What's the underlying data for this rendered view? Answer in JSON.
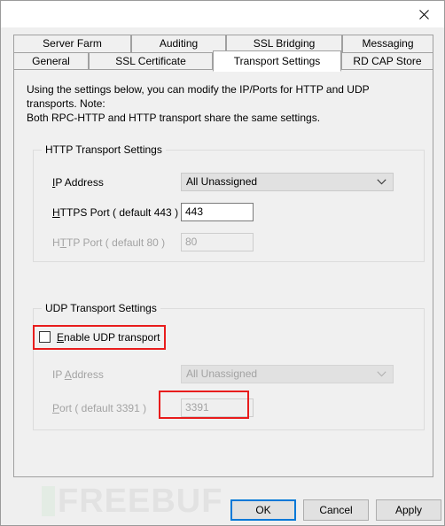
{
  "window": {
    "title": "",
    "close_icon": "close-icon"
  },
  "tabs": {
    "row_top": [
      {
        "label": "Server Farm",
        "selected": false
      },
      {
        "label": "Auditing",
        "selected": false
      },
      {
        "label": "SSL Bridging",
        "selected": false
      },
      {
        "label": "Messaging",
        "selected": false
      }
    ],
    "row_bottom": [
      {
        "label": "General",
        "selected": false
      },
      {
        "label": "SSL Certificate",
        "selected": false
      },
      {
        "label": "Transport Settings",
        "selected": true
      },
      {
        "label": "RD CAP Store",
        "selected": false
      }
    ]
  },
  "page": {
    "description_line1": "Using the settings below, you can modify the IP/Ports for HTTP and UDP transports. Note:",
    "description_line2": "Both RPC-HTTP and HTTP transport share the same settings."
  },
  "http_group": {
    "title": "HTTP Transport Settings",
    "ip_label_accel": "I",
    "ip_label_rest": "P Address",
    "ip_value": "All Unassigned",
    "https_label_accel": "H",
    "https_label_rest": "TTPS Port ( default 443 )",
    "https_value": "443",
    "http_label_pre": "H",
    "http_label_accel": "T",
    "http_label_rest": "TP Port ( default 80 )",
    "http_value": "80",
    "chevron_icon": "chevron-down-icon"
  },
  "udp_group": {
    "title": "UDP Transport Settings",
    "enable_accel": "E",
    "enable_rest": "nable UDP transport",
    "enable_checked": false,
    "ip_label_pre": "IP ",
    "ip_label_accel": "A",
    "ip_label_rest": "ddress",
    "ip_value": "All Unassigned",
    "port_label_accel": "P",
    "port_label_rest": "ort ( default 3391 )",
    "port_value": "3391",
    "chevron_icon": "chevron-down-icon"
  },
  "buttons": {
    "ok": "OK",
    "cancel": "Cancel",
    "apply": "Apply"
  },
  "watermark": {
    "text": "FREEBUF"
  },
  "colors": {
    "annotation": "#e81c1c",
    "default_button_border": "#0078d7",
    "window_background": "#efefef",
    "tabpage_background": "#f0f0f0"
  }
}
